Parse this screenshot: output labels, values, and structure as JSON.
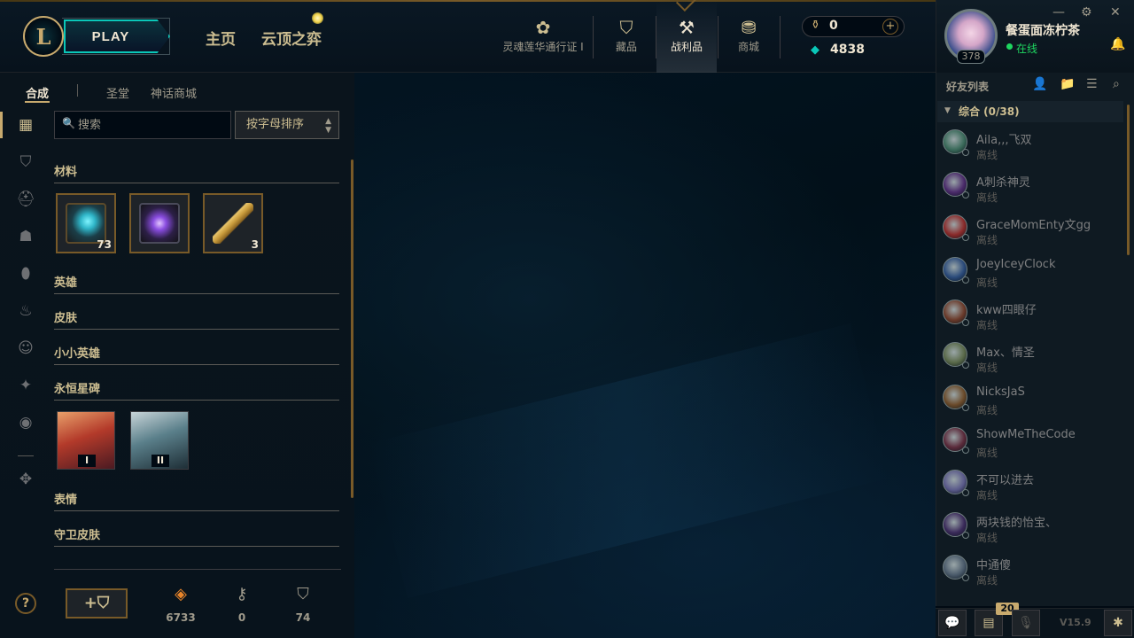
{
  "header": {
    "logo_letter": "L",
    "play_label": "PLAY",
    "nav_main": [
      "主页",
      "云顶之弈"
    ],
    "nav_icons": [
      {
        "label": "灵魂莲华通行证 I",
        "icon": "lotus-icon",
        "glyph": "✿"
      },
      {
        "label": "藏品",
        "icon": "collection-bag-icon",
        "glyph": "⛉"
      },
      {
        "label": "战利品",
        "icon": "loot-crafting-icon",
        "glyph": "⚒"
      },
      {
        "label": "商城",
        "icon": "store-coins-icon",
        "glyph": "⛃"
      }
    ],
    "currency": {
      "rp": "0",
      "be": "4838",
      "rp_glyph": "⚱",
      "be_glyph": "◆",
      "plus": "+"
    }
  },
  "profile": {
    "username": "餐蛋面冻柠茶",
    "status": "在线",
    "level": "378",
    "window_controls": {
      "minimize": "—",
      "settings": "⚙",
      "close": "✕"
    },
    "bell_glyph": "🔔"
  },
  "loot": {
    "subtabs": [
      "合成",
      "圣堂",
      "神话商城"
    ],
    "search_placeholder": "搜索",
    "search_glyph": "🔍",
    "sort_label": "按字母排序",
    "sidebar_icons": [
      {
        "name": "grid-view-icon",
        "glyph": "▦"
      },
      {
        "name": "chest-icon",
        "glyph": "⛉"
      },
      {
        "name": "champion-helmet-icon",
        "glyph": "⛑"
      },
      {
        "name": "skin-mask-icon",
        "glyph": "☗"
      },
      {
        "name": "ward-icon",
        "glyph": "⬮"
      },
      {
        "name": "emote-flame-icon",
        "glyph": "♨"
      },
      {
        "name": "smiley-icon",
        "glyph": "☺"
      },
      {
        "name": "little-legend-icon",
        "glyph": "✦"
      },
      {
        "name": "profile-icon",
        "glyph": "◉"
      },
      {
        "name": "mythic-icon",
        "glyph": "✥"
      }
    ],
    "categories": [
      "材料",
      "英雄",
      "皮肤",
      "小小英雄",
      "永恒星碑",
      "表情",
      "守卫皮肤"
    ],
    "materials": [
      {
        "name": "hextech-chest",
        "count": "73",
        "color": "#2fb5c8"
      },
      {
        "name": "masterwork-chest",
        "count": "",
        "color": "#8a4de0"
      },
      {
        "name": "hextech-key",
        "count": "3",
        "color": "#c89b3c"
      }
    ],
    "eternals": [
      {
        "numeral": "I",
        "color": "#b33a2a"
      },
      {
        "numeral": "II",
        "color": "#5a7f8a"
      }
    ],
    "help_label": "?",
    "craft_label": "+⛉",
    "resources": [
      {
        "name": "orange-essence-icon",
        "glyph": "◈",
        "value": "6733",
        "color": "#e8852a"
      },
      {
        "name": "key-fragment-icon",
        "glyph": "⚷",
        "value": "0",
        "color": "#a09b8c"
      },
      {
        "name": "chest-count-icon",
        "glyph": "⛉",
        "value": "74",
        "color": "#a09b8c"
      }
    ]
  },
  "friends": {
    "title": "好友列表",
    "tools": [
      {
        "name": "add-friend-icon",
        "glyph": "👤"
      },
      {
        "name": "add-folder-icon",
        "glyph": "📁"
      },
      {
        "name": "list-view-icon",
        "glyph": "☰"
      },
      {
        "name": "search-icon",
        "glyph": "⌕"
      }
    ],
    "group": "综合 (0/38)",
    "group_caret": "▼",
    "offline_label": "离线",
    "list": [
      {
        "name": "Aila,,,飞双",
        "color": "#3a6a5a"
      },
      {
        "name": "A刺杀神灵",
        "color": "#4a2a6a"
      },
      {
        "name": "GraceMomEnty文gg",
        "color": "#8a2a2a"
      },
      {
        "name": "JoeyIceyClock",
        "color": "#2a4a7a"
      },
      {
        "name": "kww四眼仔",
        "color": "#6a3a2a"
      },
      {
        "name": "Max、情圣",
        "color": "#5a6a4a"
      },
      {
        "name": "NicksJaS",
        "color": "#6a4a2a"
      },
      {
        "name": "ShowMeTheCode",
        "color": "#5a2a3a"
      },
      {
        "name": "不可以进去",
        "color": "#5a5a8a"
      },
      {
        "name": "两块钱的怡宝、",
        "color": "#3a2a5a"
      },
      {
        "name": "中通傻",
        "color": "#4a5a6a"
      }
    ]
  },
  "dock": {
    "chat_glyph": "💬",
    "missions_glyph": "▤",
    "missions_badge": "20",
    "mic_glyph": "🎙",
    "version": "V15.9",
    "bug_glyph": "✱"
  },
  "colors": {
    "gold": "#c8aa6e",
    "accent_teal": "#0ac8b9",
    "online": "#1ed760"
  }
}
